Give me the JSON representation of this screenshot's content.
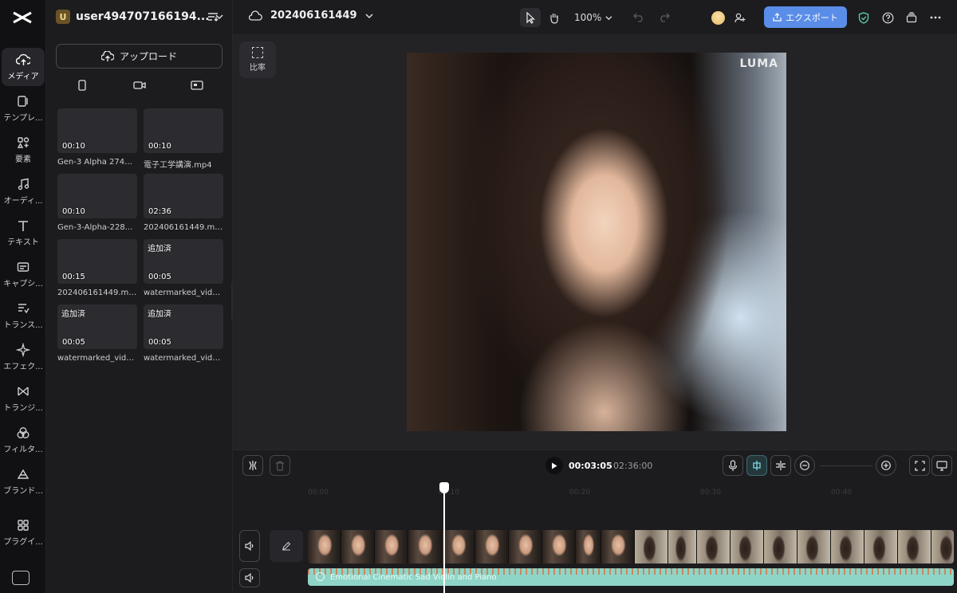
{
  "rail": {
    "items": [
      {
        "label": "メディア",
        "icon": "cloud-upload-icon",
        "active": true
      },
      {
        "label": "テンプレ...",
        "icon": "template-icon"
      },
      {
        "label": "要素",
        "icon": "elements-icon"
      },
      {
        "label": "オーディ...",
        "icon": "music-note-icon"
      },
      {
        "label": "テキスト",
        "icon": "text-icon"
      },
      {
        "label": "キャプシ...",
        "icon": "caption-icon"
      },
      {
        "label": "トランス...",
        "icon": "transcript-icon"
      },
      {
        "label": "エフェク...",
        "icon": "sparkle-icon"
      },
      {
        "label": "トランジ...",
        "icon": "transition-icon"
      },
      {
        "label": "フィルタ...",
        "icon": "filter-icon"
      },
      {
        "label": "ブランド...",
        "icon": "brand-icon"
      },
      {
        "label": "プラグイ...",
        "icon": "plugin-grid-icon"
      }
    ]
  },
  "panel": {
    "avatar_letter": "U",
    "username": "user494707166194...",
    "upload_label": "アップロード",
    "media": [
      {
        "name": "Gen-3 Alpha 27431...",
        "duration": "00:10",
        "tag": "",
        "style": "room"
      },
      {
        "name": "電子工学講演.mp4",
        "duration": "00:10",
        "tag": "",
        "style": "room"
      },
      {
        "name": "Gen-3-Alpha-228...",
        "duration": "00:10",
        "tag": "",
        "style": "snow"
      },
      {
        "name": "202406161449.mp4",
        "duration": "02:36",
        "tag": "",
        "style": "portrait"
      },
      {
        "name": "202406161449.mp4",
        "duration": "00:15",
        "tag": "",
        "style": "portrait"
      },
      {
        "name": "watermarked_vide...",
        "duration": "00:05",
        "tag": "追加済",
        "style": "back"
      },
      {
        "name": "watermarked_vide...",
        "duration": "00:05",
        "tag": "追加済",
        "style": "portrait"
      },
      {
        "name": "watermarked_vide...",
        "duration": "00:05",
        "tag": "追加済",
        "style": "portrait"
      }
    ]
  },
  "topbar": {
    "project_name": "202406161449",
    "zoom": "100%",
    "export_label": "エクスポート"
  },
  "preview": {
    "ratio_label": "比率",
    "watermark": "LUMA"
  },
  "timeline": {
    "current_time": "00:03:05",
    "total_time": "02:36:00",
    "ruler_ticks": [
      "00:00",
      "00:10",
      "00:20",
      "00:30",
      "00:40"
    ],
    "audio_label": "Emotional Cinematic Sad Violin and Piano"
  },
  "colors": {
    "accent": "#5a8de8",
    "audio_track": "#8fd5c7"
  }
}
